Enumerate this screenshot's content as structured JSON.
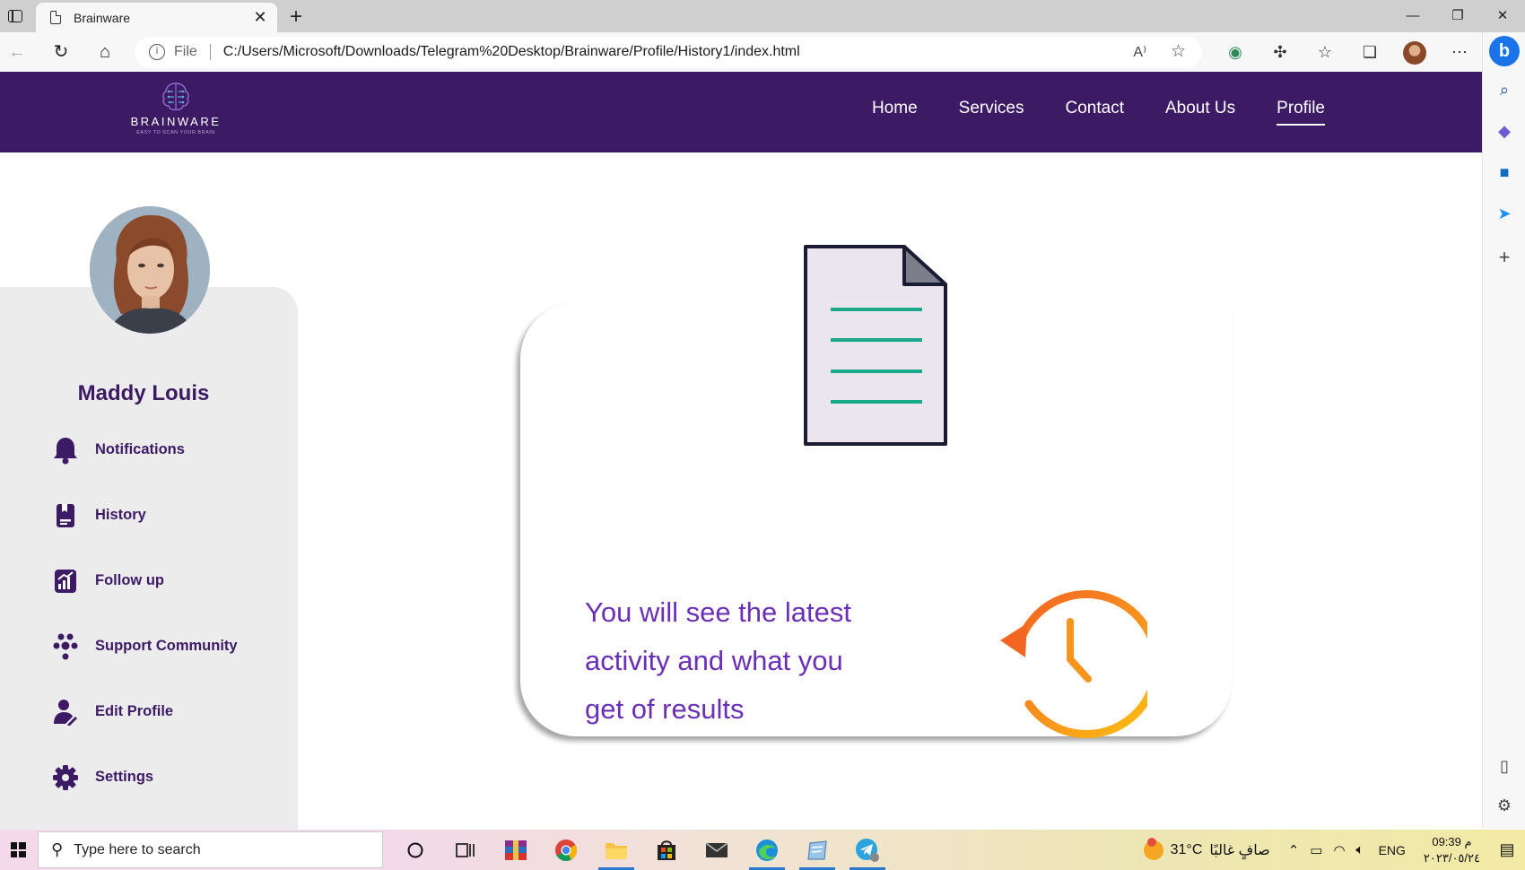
{
  "browser": {
    "tab_title": "Brainware",
    "tab_close": "✕",
    "new_tab": "+",
    "window_controls": {
      "minimize": "—",
      "maximize": "❐",
      "close": "✕"
    },
    "url_scheme_label": "File",
    "url": "C:/Users/Microsoft/Downloads/Telegram%20Desktop/Brainware/Profile/History1/index.html"
  },
  "site": {
    "logo": {
      "name": "BRAINWARE",
      "tagline": "EASY TO SCAN YOUR BRAIN"
    },
    "nav": [
      {
        "label": "Home",
        "active": false
      },
      {
        "label": "Services",
        "active": false
      },
      {
        "label": "Contact",
        "active": false
      },
      {
        "label": "About Us",
        "active": false
      },
      {
        "label": "Profile",
        "active": true
      }
    ],
    "profile": {
      "name": "Maddy Louis",
      "menu": [
        {
          "label": "Notifications",
          "icon": "bell-icon"
        },
        {
          "label": "History",
          "icon": "history-book-icon"
        },
        {
          "label": "Follow up",
          "icon": "chart-icon"
        },
        {
          "label": "Support Community",
          "icon": "community-icon"
        },
        {
          "label": "Edit Profile",
          "icon": "user-edit-icon"
        },
        {
          "label": "Settings",
          "icon": "gear-icon"
        }
      ]
    },
    "history_card": {
      "line1": "You will see the latest",
      "line2": "activity and what you",
      "line3": "get of results"
    }
  },
  "taskbar": {
    "search_placeholder": "Type here to search",
    "temperature": "31°C",
    "condition": "صافٍ غالبًا",
    "language": "ENG",
    "time": "09:39 م",
    "date": "٢٠٢٣/٠٥/٢٤"
  },
  "colors": {
    "brand_purple": "#3d1a64",
    "text_purple": "#6a2fb5",
    "sidebar_bg": "#ececec",
    "doc_lines": "#1aa98a",
    "clock_orange": "#f7941d"
  }
}
